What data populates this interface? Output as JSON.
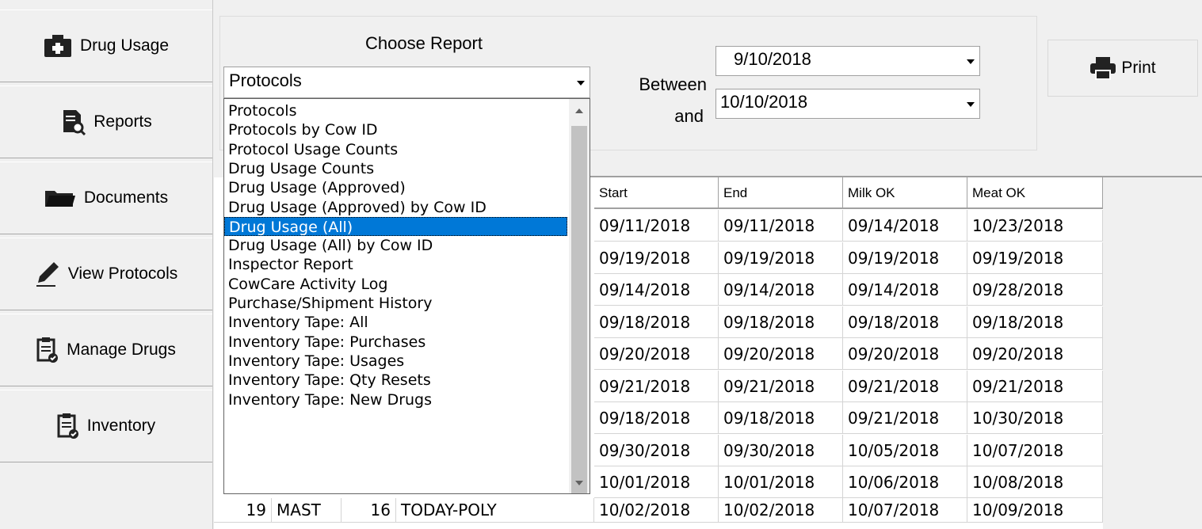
{
  "sidebar": {
    "items": [
      {
        "label": "Drug Usage",
        "icon": "medkit-icon"
      },
      {
        "label": "Reports",
        "icon": "report-search-icon"
      },
      {
        "label": "Documents",
        "icon": "folder-icon"
      },
      {
        "label": "View Protocols",
        "icon": "pen-icon"
      },
      {
        "label": "Manage Drugs",
        "icon": "clipboard-check-icon"
      },
      {
        "label": "Inventory",
        "icon": "clipboard-check-icon"
      }
    ]
  },
  "report": {
    "title": "Choose Report",
    "selected": "Protocols",
    "options": [
      "Protocols",
      "Protocols by Cow ID",
      "Protocol Usage Counts",
      "Drug Usage Counts",
      "Drug Usage (Approved)",
      "Drug Usage (Approved) by Cow ID",
      "Drug Usage (All)",
      "Drug Usage (All) by Cow ID",
      "Inspector Report",
      "CowCare Activity Log",
      "Purchase/Shipment History",
      "Inventory Tape: All",
      "Inventory Tape: Purchases",
      "Inventory Tape: Usages",
      "Inventory Tape: Qty Resets",
      "Inventory Tape: New Drugs"
    ],
    "highlighted": "Drug Usage (All)"
  },
  "dates": {
    "between_label": "Between",
    "and_label": "and",
    "from": "9/10/2018",
    "to": "10/10/2018"
  },
  "print": {
    "label": "Print"
  },
  "grid": {
    "headers": [
      "Start",
      "End",
      "Milk OK",
      "Meat OK"
    ],
    "rows": [
      [
        "09/11/2018",
        "09/11/2018",
        "09/14/2018",
        "10/23/2018"
      ],
      [
        "09/19/2018",
        "09/19/2018",
        "09/19/2018",
        "09/19/2018"
      ],
      [
        "09/14/2018",
        "09/14/2018",
        "09/14/2018",
        "09/28/2018"
      ],
      [
        "09/18/2018",
        "09/18/2018",
        "09/18/2018",
        "09/18/2018"
      ],
      [
        "09/20/2018",
        "09/20/2018",
        "09/20/2018",
        "09/20/2018"
      ],
      [
        "09/21/2018",
        "09/21/2018",
        "09/21/2018",
        "09/21/2018"
      ],
      [
        "09/18/2018",
        "09/18/2018",
        "09/21/2018",
        "10/30/2018"
      ],
      [
        "09/30/2018",
        "09/30/2018",
        "10/05/2018",
        "10/07/2018"
      ],
      [
        "10/01/2018",
        "10/01/2018",
        "10/06/2018",
        "10/08/2018"
      ],
      [
        "10/02/2018",
        "10/02/2018",
        "10/07/2018",
        "10/09/2018"
      ]
    ],
    "last_row_partial": {
      "num": "19",
      "type": "MAST",
      "qty": "16",
      "drug": "TODAY-POLY"
    }
  }
}
